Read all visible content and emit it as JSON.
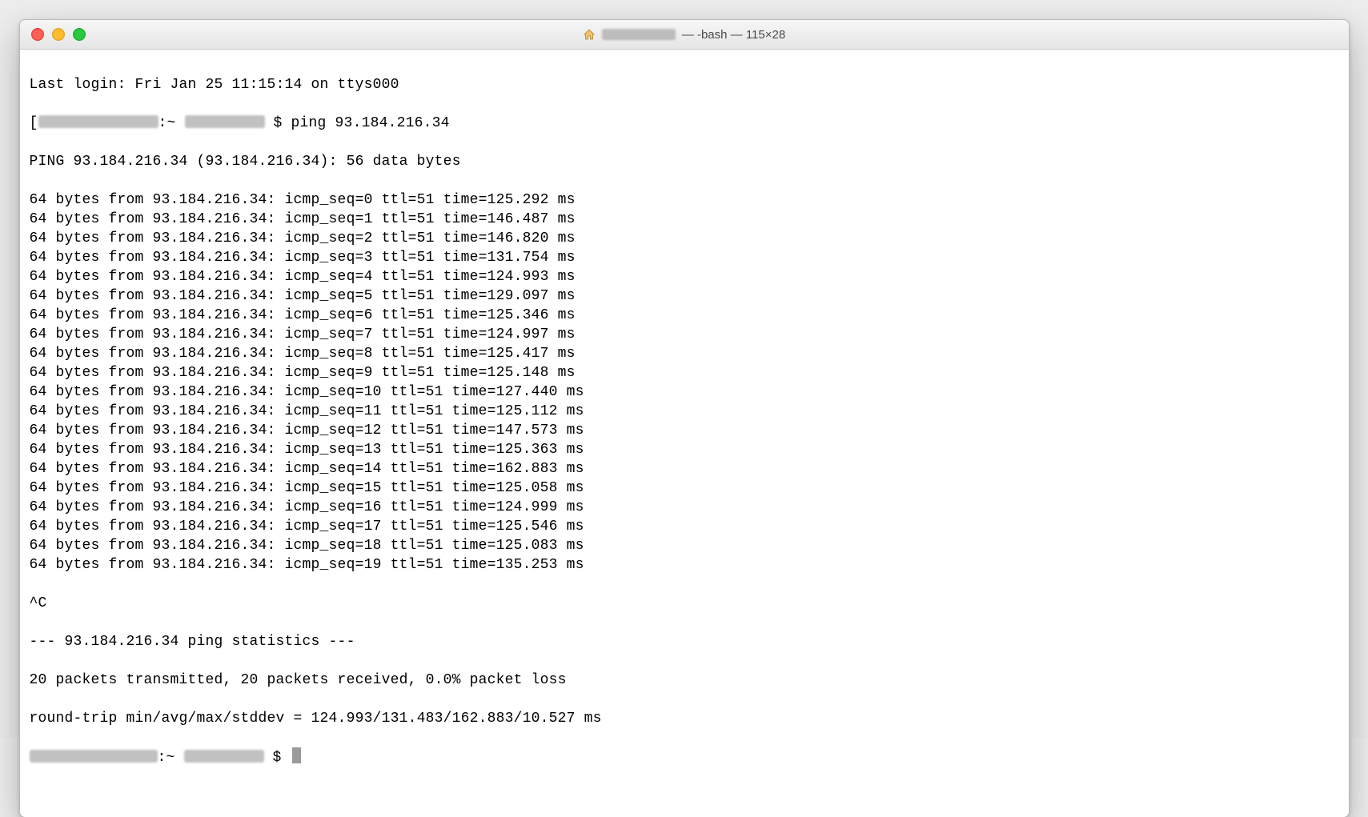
{
  "window": {
    "title_tail": " — -bash — 115×28"
  },
  "term": {
    "last_login": "Last login: Fri Jan 25 11:15:14 on ttys000",
    "prompt_host_obscured": true,
    "prompt_cmd": "$ ping 93.184.216.34",
    "prompt_sep": ":~ ",
    "ping_header": "PING 93.184.216.34 (93.184.216.34): 56 data bytes",
    "reply_prefix": "64 bytes from 93.184.216.34: icmp_seq=",
    "reply_mid": " ttl=51 time=",
    "reply_suffix": " ms",
    "replies": [
      {
        "seq": 0,
        "time": "125.292"
      },
      {
        "seq": 1,
        "time": "146.487"
      },
      {
        "seq": 2,
        "time": "146.820"
      },
      {
        "seq": 3,
        "time": "131.754"
      },
      {
        "seq": 4,
        "time": "124.993"
      },
      {
        "seq": 5,
        "time": "129.097"
      },
      {
        "seq": 6,
        "time": "125.346"
      },
      {
        "seq": 7,
        "time": "124.997"
      },
      {
        "seq": 8,
        "time": "125.417"
      },
      {
        "seq": 9,
        "time": "125.148"
      },
      {
        "seq": 10,
        "time": "127.440"
      },
      {
        "seq": 11,
        "time": "125.112"
      },
      {
        "seq": 12,
        "time": "147.573"
      },
      {
        "seq": 13,
        "time": "125.363"
      },
      {
        "seq": 14,
        "time": "162.883"
      },
      {
        "seq": 15,
        "time": "125.058"
      },
      {
        "seq": 16,
        "time": "124.999"
      },
      {
        "seq": 17,
        "time": "125.546"
      },
      {
        "seq": 18,
        "time": "125.083"
      },
      {
        "seq": 19,
        "time": "135.253"
      }
    ],
    "interrupt": "^C",
    "stats_header": "--- 93.184.216.34 ping statistics ---",
    "stats_packets": "20 packets transmitted, 20 packets received, 0.0% packet loss",
    "stats_rtt": "round-trip min/avg/max/stddev = 124.993/131.483/162.883/10.527 ms",
    "prompt2_dollar": "$ "
  }
}
